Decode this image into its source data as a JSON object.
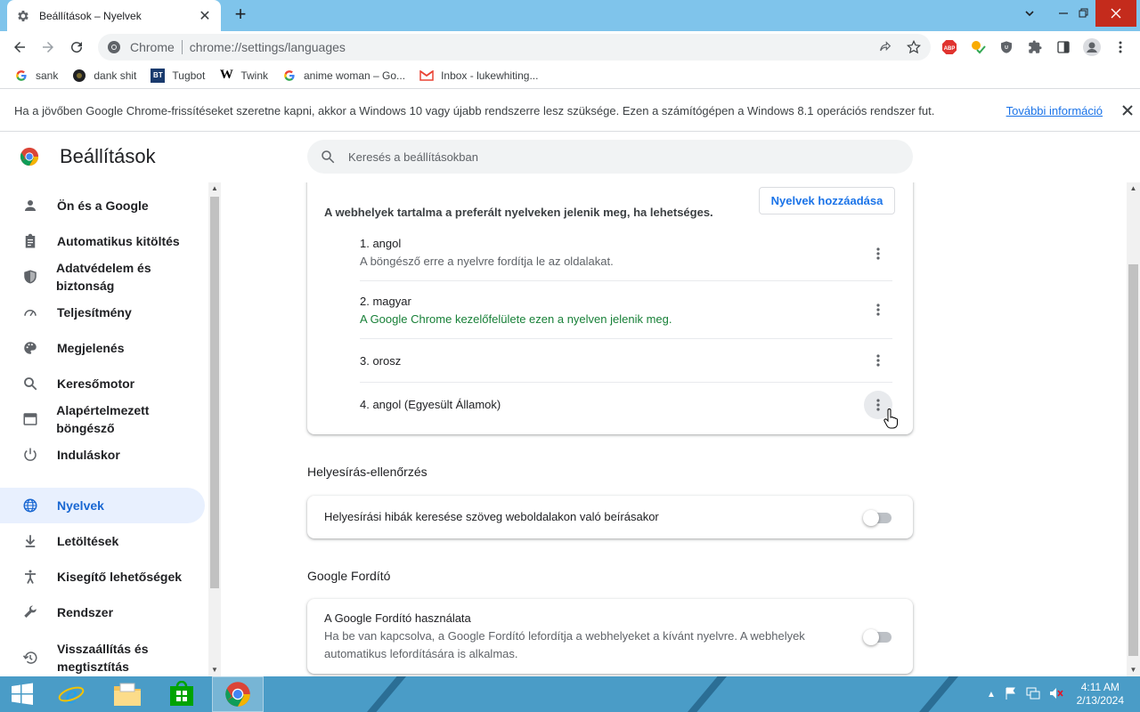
{
  "browser": {
    "tab_title": "Beállítások – Nyelvek",
    "new_tab": "+",
    "omnibox_scheme": "Chrome",
    "omnibox_url": "chrome://settings/languages",
    "bookmarks": [
      {
        "label": "sank",
        "icon": "google-icon"
      },
      {
        "label": "dank shit",
        "icon": "dark-circle-icon"
      },
      {
        "label": "Tugbot",
        "icon": "bt-icon"
      },
      {
        "label": "Twink",
        "icon": "wikipedia-w-icon"
      },
      {
        "label": "anime woman – Go...",
        "icon": "google-icon"
      },
      {
        "label": "Inbox - lukewhiting...",
        "icon": "gmail-icon"
      }
    ]
  },
  "infobar": {
    "message": "Ha a jövőben Google Chrome-frissítéseket szeretne kapni, akkor a Windows 10 vagy újabb rendszerre lesz szüksége. Ezen a számítógépen a Windows 8.1 operációs rendszer fut.",
    "link": "További információ"
  },
  "settings": {
    "title": "Beállítások",
    "search_placeholder": "Keresés a beállításokban"
  },
  "sidebar": {
    "items": [
      {
        "label": "Ön és a Google",
        "icon": "person-icon"
      },
      {
        "label": "Automatikus kitöltés",
        "icon": "clipboard-icon"
      },
      {
        "label": "Adatvédelem és biztonság",
        "icon": "shield-icon"
      },
      {
        "label": "Teljesítmény",
        "icon": "speedometer-icon"
      },
      {
        "label": "Megjelenés",
        "icon": "palette-icon"
      },
      {
        "label": "Keresőmotor",
        "icon": "search-icon"
      },
      {
        "label": "Alapértelmezett böngésző",
        "icon": "browser-window-icon"
      },
      {
        "label": "Induláskor",
        "icon": "power-icon"
      },
      {
        "label": "Nyelvek",
        "icon": "globe-icon",
        "active": true
      },
      {
        "label": "Letöltések",
        "icon": "download-icon"
      },
      {
        "label": "Kisegítő lehetőségek",
        "icon": "accessibility-icon"
      },
      {
        "label": "Rendszer",
        "icon": "wrench-icon"
      },
      {
        "label": "Visszaállítás és megtisztítás",
        "icon": "restore-icon"
      }
    ]
  },
  "languages": {
    "description": "A webhelyek tartalma a preferált nyelveken jelenik meg, ha lehetséges.",
    "add_button": "Nyelvek hozzáadása",
    "list": [
      {
        "name": "1. angol",
        "sub": "A böngésző erre a nyelvre fordítja le az oldalakat."
      },
      {
        "name": "2. magyar",
        "sub": "A Google Chrome kezelőfelülete ezen a nyelven jelenik meg."
      },
      {
        "name": "3. orosz",
        "sub": ""
      },
      {
        "name": "4. angol (Egyesült Államok)",
        "sub": ""
      }
    ]
  },
  "spellcheck": {
    "section_title": "Helyesírás-ellenőrzés",
    "toggle_label": "Helyesírási hibák keresése szöveg weboldalakon való beírásakor",
    "enabled": false
  },
  "translate": {
    "section_title": "Google Fordító",
    "toggle_label": "A Google Fordító használata",
    "toggle_sub": "Ha be van kapcsolva, a Google Fordító lefordítja a webhelyeket a kívánt nyelvre. A webhelyek automatikus lefordítására is alkalmas.",
    "enabled": false
  },
  "taskbar": {
    "time": "4:11 AM",
    "date": "2/13/2024"
  },
  "colors": {
    "accent": "#1a73e8",
    "active_nav_bg": "#e8f0fe",
    "green_text": "#188038",
    "taskbar": "#4a9cc7",
    "tabstrip": "#7fc4eb"
  }
}
